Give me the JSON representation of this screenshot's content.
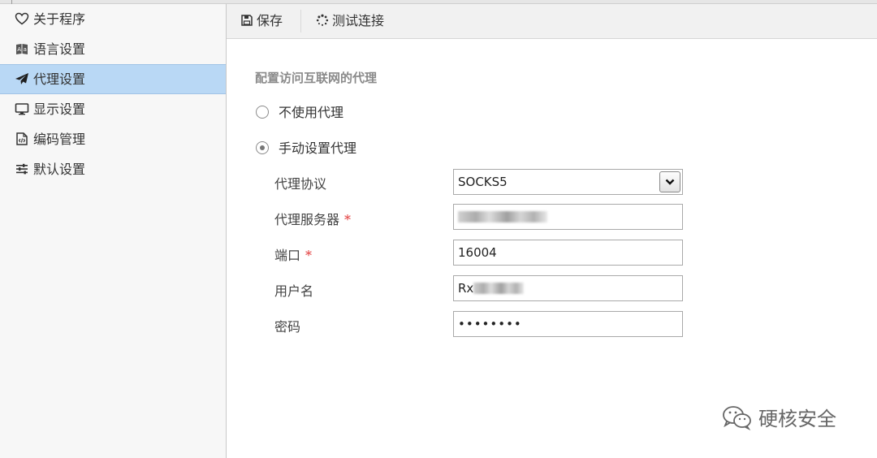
{
  "sidebar": {
    "items": [
      {
        "label": "关于程序",
        "icon": "heart-icon"
      },
      {
        "label": "语言设置",
        "icon": "book-icon"
      },
      {
        "label": "代理设置",
        "icon": "paper-plane-icon",
        "active": true
      },
      {
        "label": "显示设置",
        "icon": "monitor-icon"
      },
      {
        "label": "编码管理",
        "icon": "code-file-icon"
      },
      {
        "label": "默认设置",
        "icon": "sliders-icon"
      }
    ]
  },
  "toolbar": {
    "save_label": "保存",
    "test_label": "测试连接"
  },
  "proxy": {
    "section_title": "配置访问互联网的代理",
    "option_none": "不使用代理",
    "option_manual": "手动设置代理",
    "selected_option": "manual",
    "protocol_label": "代理协议",
    "protocol_value": "SOCKS5",
    "server_label": "代理服务器",
    "server_value": "",
    "port_label": "端口",
    "port_value": "16004",
    "username_label": "用户名",
    "username_value": "Rx",
    "password_label": "密码",
    "password_value": "••••••••",
    "required_mark": "*"
  },
  "watermark": {
    "text": "硬核安全"
  },
  "colors": {
    "active_item_bg": "#b9d8f5",
    "required": "#e23a3a",
    "toolbar_bg": "#f1f1f1"
  }
}
